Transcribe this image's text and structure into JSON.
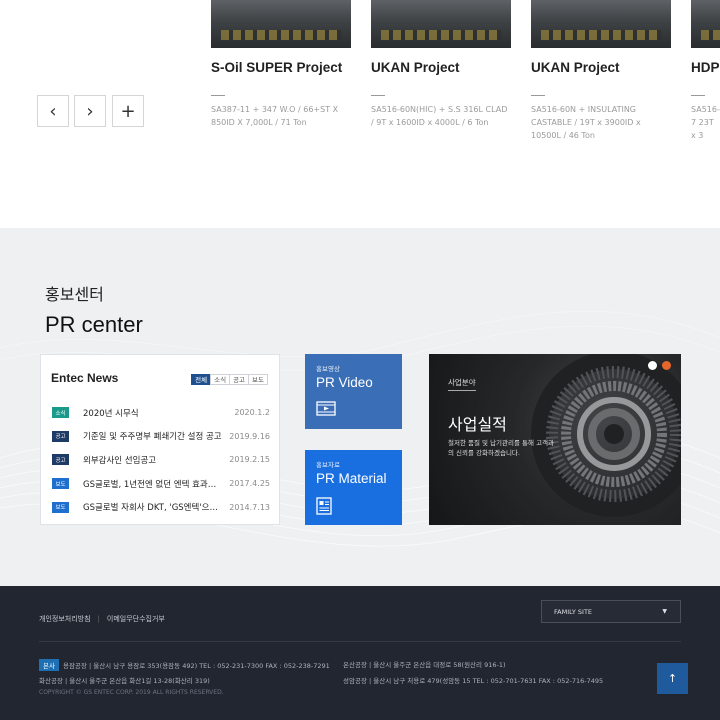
{
  "projects": {
    "nav": {
      "prev": "‹",
      "next": "›",
      "more": "+"
    },
    "items": [
      {
        "title": "S-Oil SUPER Project",
        "desc": "SA387-11 + 347 W.O / 66+ST X 850ID X 7,000L / 71 Ton"
      },
      {
        "title": "UKAN Project",
        "desc": "SA516-60N(HIC) + S.S 316L CLAD / 9T x 1600ID x 4000L / 6 Ton"
      },
      {
        "title": "UKAN Project",
        "desc": "SA516-60N + INSULATING CASTABLE / 19T x 3900ID x 10500L / 46 Ton"
      },
      {
        "title": "HDP",
        "desc": "SA516-7 23T x 3"
      }
    ]
  },
  "pr": {
    "kor_title": "홍보센터",
    "eng_title": "PR center",
    "news": {
      "title": "Entec News",
      "tabs": [
        "전체",
        "소식",
        "공고",
        "보도"
      ],
      "rows": [
        {
          "badge": "소식",
          "badge_color": "#1a9a8a",
          "text": "2020년 시무식",
          "date": "2020.1.2"
        },
        {
          "badge": "공고",
          "badge_color": "#1e3a66",
          "text": "기준일 및 주주명부 폐쇄기간 설정 공고",
          "date": "2019.9.16"
        },
        {
          "badge": "공고",
          "badge_color": "#1e3a66",
          "text": "외부감사인 선임공고",
          "date": "2019.2.15"
        },
        {
          "badge": "보도",
          "badge_color": "#1f6fcf",
          "text": "GS글로벌, 1년전엔 없던 엔텍 효과……",
          "date": "2017.4.25"
        },
        {
          "badge": "보도",
          "badge_color": "#1f6fcf",
          "text": "GS글로벌 자회사 DKT, 'GS엔텍'으로…",
          "date": "2014.7.13"
        }
      ]
    },
    "video": {
      "sub": "홍보영상",
      "label": "PR Video",
      "color": "#3a6fb7"
    },
    "material": {
      "sub": "홍보자료",
      "label": "PR Material",
      "color": "#1a6fe0"
    },
    "business": {
      "sub": "사업분야",
      "title": "사업실적",
      "desc": "철저한 품질 및 납기관리를 통해 고객과의 신뢰를 강화하겠습니다.",
      "dot_colors": [
        "#ffffff",
        "#e8662a"
      ]
    }
  },
  "footer": {
    "links": [
      "개인정보처리방침",
      "이메일무단수집거부"
    ],
    "family_site": "FAMILY SITE",
    "hq_tag": "본사",
    "addr1": "용잠공장 | 울산시 남구 용잠로 353(용잠동 492) TEL : 052-231-7300 FAX : 052-238-7291",
    "addr2": "화산공장 | 울산시 울주군 온산읍 화산1길 13-28(화산리 319)",
    "addr3": "온산공장 | 울산시 울주군 온산읍 대정로 58(원산리 916-1)",
    "addr4": "성암공장 | 울산시 남구 처용로 479(성암동 15 TEL : 052-701-7631 FAX : 052-716-7495",
    "copyright": "COPYRIGHT © GS ENTEC CORP. 2019 ALL RIGHTS RESERVED.",
    "top_label": "↑"
  }
}
